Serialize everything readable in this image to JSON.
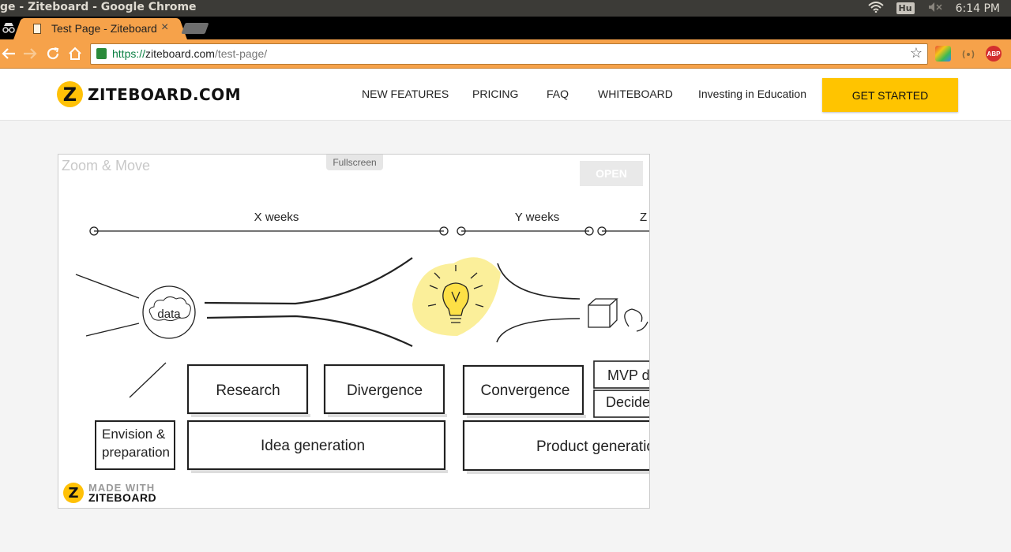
{
  "os": {
    "window_title": "ge - Ziteboard - Google Chrome",
    "keyboard_indicator": "Hu",
    "time": "6:14 PM"
  },
  "browser": {
    "tab_title": "Test Page - Ziteboard",
    "tab_close": "×",
    "url_scheme": "https://",
    "url_host": "ziteboard.com",
    "url_path": "/test-page/",
    "accent_color": "#f6a24a"
  },
  "site": {
    "logo_text": "ZITEBOARD.COM",
    "nav": [
      "NEW FEATURES",
      "PRICING",
      "FAQ",
      "WHITEBOARD",
      "Investing in Education"
    ],
    "cta": "GET STARTED",
    "cta_color": "#ffc400"
  },
  "embed": {
    "zoom_move": "Zoom & Move",
    "fullscreen": "Fullscreen",
    "open": "OPEN",
    "made_with_1": "MADE WITH",
    "made_with_2": "ZITEBOARD",
    "drawing": {
      "timeline_labels": [
        "X weeks",
        "Y weeks",
        "Z"
      ],
      "data_label": "data",
      "boxes": {
        "research": "Research",
        "divergence": "Divergence",
        "convergence": "Convergence",
        "mvp": "MVP de",
        "decide": "Decide",
        "envision_1": "Envision &",
        "envision_2": "preparation",
        "idea": "Idea generation",
        "product": "Product generatio"
      },
      "bulb_color": "#fbef9a"
    }
  }
}
